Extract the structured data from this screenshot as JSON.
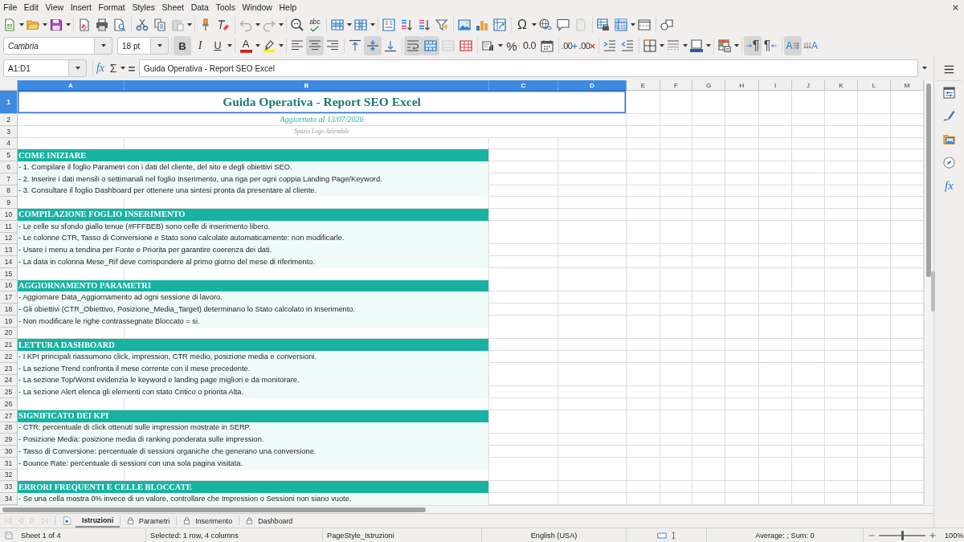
{
  "menu_bar": [
    "File",
    "Edit",
    "View",
    "Insert",
    "Format",
    "Styles",
    "Sheet",
    "Data",
    "Tools",
    "Window",
    "Help"
  ],
  "standard_toolbar": {
    "paste": {
      "disabled": true
    },
    "undo": {
      "disabled": true
    },
    "redo": {
      "disabled": true
    },
    "spelling_label": "abc",
    "special_character_label": "Ω",
    "header_footer": {
      "disabled": true
    }
  },
  "formatting_toolbar": {
    "font_name": "Cambria",
    "font_size": "18 pt",
    "bold": {
      "label": "B",
      "on": true
    },
    "italic": {
      "label": "I",
      "on": false
    },
    "underline": {
      "label": "U",
      "on": false
    },
    "font_color_label": "A",
    "align_left": {
      "on": false
    },
    "align_center": {
      "on": true
    },
    "align_right": {
      "on": false
    },
    "align_top": {
      "on": false
    },
    "align_middle": {
      "on": true
    },
    "align_bottom": {
      "on": false
    },
    "wrap_text": {
      "on": true
    },
    "merge_and_center": {
      "on": true
    },
    "merge_cells": {
      "disabled": true
    },
    "percent_label": "%",
    "number_label": "0.0",
    "add_decimal_label": ".00",
    "delete_decimal_label": ".00",
    "paragraph_ltr": {
      "label": "¶",
      "on": true
    },
    "paragraph_rtl": {
      "label": "¶",
      "on": false
    },
    "text_horizontal": {
      "label": "A",
      "on": true
    },
    "text_vertical": {
      "label": "A",
      "on": false
    }
  },
  "formula_bar": {
    "name_box": "A1:D1",
    "function_wizard_label": "fx",
    "sum_label": "Σ",
    "formula_label": "=",
    "content": "Guida Operativa - Report SEO Excel"
  },
  "sheet": {
    "columns": [
      {
        "label": "A",
        "selected": true
      },
      {
        "label": "B",
        "selected": true
      },
      {
        "label": "C",
        "selected": true
      },
      {
        "label": "D",
        "selected": true
      },
      {
        "label": "E",
        "selected": false
      },
      {
        "label": "F",
        "selected": false
      },
      {
        "label": "G",
        "selected": false
      },
      {
        "label": "H",
        "selected": false
      },
      {
        "label": "I",
        "selected": false
      },
      {
        "label": "J",
        "selected": false
      },
      {
        "label": "K",
        "selected": false
      },
      {
        "label": "L",
        "selected": false
      },
      {
        "label": "M",
        "selected": false
      }
    ],
    "rows": [
      {
        "number": "1",
        "selected": true,
        "kind": "title",
        "text": "Guida Operativa - Report SEO Excel"
      },
      {
        "number": "2",
        "selected": false,
        "kind": "subtitle",
        "text": "Aggiornato al 13/07/2026"
      },
      {
        "number": "3",
        "selected": false,
        "kind": "note",
        "text": "Spazio Logo Aziendale"
      },
      {
        "number": "4",
        "selected": false,
        "kind": "blank"
      },
      {
        "number": "5",
        "selected": false,
        "kind": "section",
        "text": "COME INIZIARE"
      },
      {
        "number": "6",
        "selected": false,
        "kind": "item",
        "text": "- 1. Compilare il foglio Parametri con i dati del cliente, del sito e degli obiettivi SEO."
      },
      {
        "number": "7",
        "selected": false,
        "kind": "item",
        "text": "- 2. Inserire i dati mensili o settimanali nel foglio Inserimento, una riga per ogni coppia Landing Page/Keyword."
      },
      {
        "number": "8",
        "selected": false,
        "kind": "item",
        "text": "- 3. Consultare il foglio Dashboard per ottenere una sintesi pronta da presentare al cliente."
      },
      {
        "number": "9",
        "selected": false,
        "kind": "blank"
      },
      {
        "number": "10",
        "selected": false,
        "kind": "section",
        "text": "COMPILAZIONE FOGLIO INSERIMENTO"
      },
      {
        "number": "11",
        "selected": false,
        "kind": "item",
        "text": "- Le celle su sfondo giallo tenue (#FFFBEB) sono celle di inserimento libero."
      },
      {
        "number": "12",
        "selected": false,
        "kind": "item",
        "text": "- Le colonne CTR, Tasso di Conversione e Stato sono calcolate automaticamente: non modificarle."
      },
      {
        "number": "13",
        "selected": false,
        "kind": "item",
        "text": "- Usare i menu a tendina per Fonte e Priorita per garantire coerenza dei dati."
      },
      {
        "number": "14",
        "selected": false,
        "kind": "item",
        "text": "- La data in colonna Mese_Rif deve corrispondere al primo giorno del mese di riferimento."
      },
      {
        "number": "15",
        "selected": false,
        "kind": "blank"
      },
      {
        "number": "16",
        "selected": false,
        "kind": "section",
        "text": "AGGIORNAMENTO PARAMETRI"
      },
      {
        "number": "17",
        "selected": false,
        "kind": "item",
        "text": "- Aggiornare Data_Aggiornamento ad ogni sessione di lavoro."
      },
      {
        "number": "18",
        "selected": false,
        "kind": "item",
        "text": "- Gli obiettivi (CTR_Obiettivo, Posizione_Media_Target) determinano lo Stato calcolato in Inserimento."
      },
      {
        "number": "19",
        "selected": false,
        "kind": "item",
        "text": "- Non modificare le righe contrassegnate Bloccato = si."
      },
      {
        "number": "20",
        "selected": false,
        "kind": "blank"
      },
      {
        "number": "21",
        "selected": false,
        "kind": "section",
        "text": "LETTURA DASHBOARD"
      },
      {
        "number": "22",
        "selected": false,
        "kind": "item",
        "text": "- I KPI principali riassumono click, impression, CTR medio, posizione media e conversioni."
      },
      {
        "number": "23",
        "selected": false,
        "kind": "item",
        "text": "- La sezione Trend confronta il mese corrente con il mese precedente."
      },
      {
        "number": "24",
        "selected": false,
        "kind": "item",
        "text": "- La sezione Top/Worst evidenzia le keyword e landing page migliori e da monitorare."
      },
      {
        "number": "25",
        "selected": false,
        "kind": "item",
        "text": "- La sezione Alert elenca gli elementi con stato Critico o priorita Alta."
      },
      {
        "number": "26",
        "selected": false,
        "kind": "blank"
      },
      {
        "number": "27",
        "selected": false,
        "kind": "section",
        "text": "SIGNIFICATO DEI KPI"
      },
      {
        "number": "28",
        "selected": false,
        "kind": "item",
        "text": "- CTR: percentuale di click ottenuti sulle impression mostrate in SERP."
      },
      {
        "number": "29",
        "selected": false,
        "kind": "item",
        "text": "- Posizione Media: posizione media di ranking ponderata sulle impression."
      },
      {
        "number": "30",
        "selected": false,
        "kind": "item",
        "text": "- Tasso di Conversione: percentuale di sessioni organiche che generano una conversione."
      },
      {
        "number": "31",
        "selected": false,
        "kind": "item",
        "text": "- Bounce Rate: percentuale di sessioni con una sola pagina visitata."
      },
      {
        "number": "32",
        "selected": false,
        "kind": "blank"
      },
      {
        "number": "33",
        "selected": false,
        "kind": "section",
        "text": "ERRORI FREQUENTI E CELLE BLOCCATE"
      },
      {
        "number": "34",
        "selected": false,
        "kind": "item",
        "text": "- Se una cella mostra 0% invece di un valore, controllare che Impression o Sessioni non siano vuote."
      }
    ]
  },
  "sheet_navigation": {
    "disabled": true
  },
  "sheet_tabs": [
    {
      "label": "Istruzioni",
      "selected": true,
      "locked": false
    },
    {
      "label": "Parametri",
      "selected": false,
      "locked": true
    },
    {
      "label": "Inserimento",
      "selected": false,
      "locked": true
    },
    {
      "label": "Dashboard",
      "selected": false,
      "locked": true
    }
  ],
  "sidebar": {
    "functions_label": "fx"
  },
  "status_bar": {
    "sheet_position": "Sheet 1 of 4",
    "selection": "Selected: 1 row, 4 columns",
    "page_style": "PageStyle_Istruzioni",
    "language": "English (USA)",
    "statistics": "Average: ; Sum: 0",
    "zoom": {
      "level": 0.5,
      "percent": "100%"
    }
  }
}
